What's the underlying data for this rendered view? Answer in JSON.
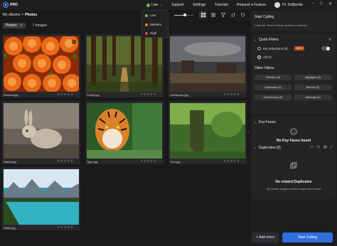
{
  "app": {
    "name": "PRO"
  },
  "titlebar": {
    "quality": "Low",
    "links": [
      "Support",
      "Settings",
      "Tutorials",
      "Request a Feature"
    ],
    "user": "Hi, Softpedia"
  },
  "quality_menu": {
    "items": [
      {
        "label": "Low",
        "color": "#63c04a"
      },
      {
        "label": "Medium",
        "color": "#e08a2c"
      },
      {
        "label": "High",
        "color": "#d04a3a"
      }
    ]
  },
  "breadcrumb": {
    "root": "My albums",
    "separator": ">",
    "current": "Photos"
  },
  "view_tabs": {
    "photos": "Photos",
    "count": "7 images"
  },
  "thumbnail_size": 0.55,
  "photos": [
    {
      "filename": "Flowers.jpg",
      "stars": "★★★★★"
    },
    {
      "filename": "Forest.jpg",
      "stars": "★★★★★"
    },
    {
      "filename": "Landscape.jpg",
      "stars": "★★★★★"
    },
    {
      "filename": "Rabbit.jpg",
      "stars": "★★★★★"
    },
    {
      "filename": "Tiger.jpg",
      "stars": "★★★★★"
    },
    {
      "filename": "Tree.jpg",
      "stars": "★★★★★"
    },
    {
      "filename": "Water.jpg",
      "stars": "★★★★★"
    }
  ],
  "panel": {
    "start": {
      "title": "Start Culling",
      "subtitle": "Click the \"Start Culling\" button to continue"
    },
    "quick_filters": {
      "title": "Quick Filters",
      "my_selections": "My Selections (0)",
      "new_badge": "NEW",
      "all": "All (7)"
    },
    "other_filters": {
      "title": "Other Filters",
      "chips": [
        "Selected (0)",
        "Highlights (0)",
        "Duplicates (0)",
        "Blurred (0)",
        "Closed Eyes (0)",
        "Warnings (0)"
      ]
    },
    "key_faces": {
      "title": "Key Faces",
      "empty": "No Key Faces found"
    },
    "duplicates": {
      "title": "Duplicates (0)",
      "empty_title": "No related Duplicates",
      "empty_sub": "No similar images to this image were found"
    }
  },
  "buttons": {
    "add_more": "+ Add more",
    "start_culling": "Start Culling"
  }
}
